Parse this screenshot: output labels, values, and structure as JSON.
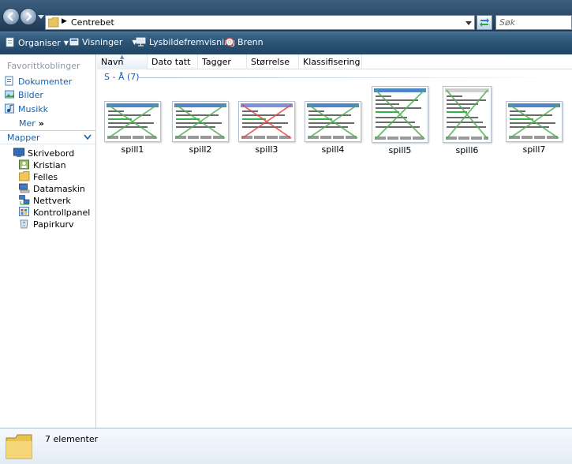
{
  "address": {
    "path": "Centrebet"
  },
  "search": {
    "placeholder": "Søk"
  },
  "toolbar": {
    "organize": "Organiser",
    "views": "Visninger",
    "slideshow": "Lysbildefremvisning",
    "burn": "Brenn"
  },
  "nav": {
    "favorites_header": "Favorittkoblinger",
    "favorites": [
      {
        "label": "Dokumenter",
        "icon": "documents-icon"
      },
      {
        "label": "Bilder",
        "icon": "pictures-icon"
      },
      {
        "label": "Musikk",
        "icon": "music-icon"
      }
    ],
    "more": "Mer",
    "folders_header": "Mapper",
    "tree": [
      {
        "label": "Skrivebord",
        "icon": "desktop-icon"
      },
      {
        "label": "Kristian",
        "icon": "user-folder-icon"
      },
      {
        "label": "Felles",
        "icon": "folder-icon"
      },
      {
        "label": "Datamaskin",
        "icon": "computer-icon"
      },
      {
        "label": "Nettverk",
        "icon": "network-icon"
      },
      {
        "label": "Kontrollpanel",
        "icon": "control-panel-icon"
      },
      {
        "label": "Papirkurv",
        "icon": "recycle-bin-icon"
      }
    ]
  },
  "columns": {
    "name": "Navn",
    "date": "Dato tatt",
    "tags": "Tagger",
    "size": "Størrelse",
    "rating": "Klassifisering"
  },
  "group": {
    "label": "S - Å (7)"
  },
  "files": [
    {
      "name": "spill1",
      "cross_color": "#4caf50"
    },
    {
      "name": "spill2",
      "cross_color": "#4caf50"
    },
    {
      "name": "spill3",
      "cross_color": "#e04848"
    },
    {
      "name": "spill4",
      "cross_color": "#4caf50"
    },
    {
      "name": "spill5",
      "cross_color": "#4caf50"
    },
    {
      "name": "spill6",
      "cross_color": "#4caf50"
    },
    {
      "name": "spill7",
      "cross_color": "#4caf50"
    }
  ],
  "details": {
    "count_text": "7 elementer"
  }
}
